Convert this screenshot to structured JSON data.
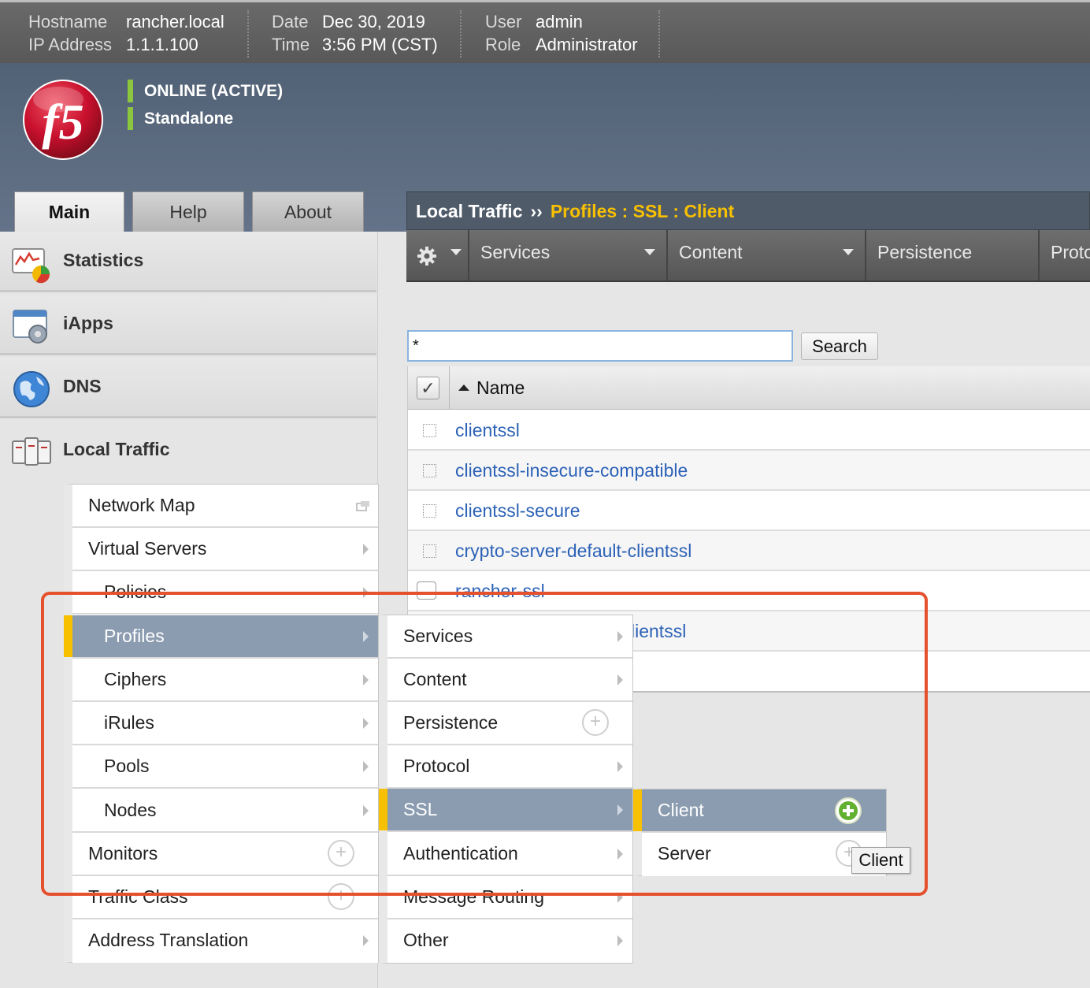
{
  "topbar": {
    "hostname_label": "Hostname",
    "hostname": "rancher.local",
    "ip_label": "IP Address",
    "ip": "1.1.1.100",
    "date_label": "Date",
    "date": "Dec 30, 2019",
    "time_label": "Time",
    "time": "3:56 PM (CST)",
    "user_label": "User",
    "user": "admin",
    "role_label": "Role",
    "role": "Administrator"
  },
  "status": {
    "online": "ONLINE (ACTIVE)",
    "mode": "Standalone",
    "indicator_color": "#8cc63f"
  },
  "logo": {
    "text": "f5",
    "color": "#c8102e"
  },
  "tabs": [
    {
      "label": "Main"
    },
    {
      "label": "Help"
    },
    {
      "label": "About"
    }
  ],
  "breadcrumb": {
    "section": "Local Traffic",
    "separator": "››",
    "current": "Profiles : SSL : Client"
  },
  "navbar": {
    "gear_icon": "gear-icon",
    "items": [
      {
        "label": "Services"
      },
      {
        "label": "Content"
      },
      {
        "label": "Persistence"
      },
      {
        "label": "Proto"
      }
    ]
  },
  "sidebar": {
    "categories": [
      {
        "label": "Statistics",
        "icon": "statistics-icon"
      },
      {
        "label": "iApps",
        "icon": "iapps-icon"
      },
      {
        "label": "DNS",
        "icon": "globe-icon"
      },
      {
        "label": "Local Traffic",
        "icon": "local-traffic-icon"
      }
    ],
    "local_traffic_menu": [
      {
        "label": "Network Map"
      },
      {
        "label": "Virtual Servers"
      },
      {
        "label": "Policies"
      },
      {
        "label": "Profiles"
      },
      {
        "label": "Ciphers"
      },
      {
        "label": "iRules"
      },
      {
        "label": "Pools"
      },
      {
        "label": "Nodes"
      },
      {
        "label": "Monitors"
      },
      {
        "label": "Traffic Class"
      },
      {
        "label": "Address Translation"
      }
    ]
  },
  "profiles_menu": [
    {
      "label": "Services"
    },
    {
      "label": "Content"
    },
    {
      "label": "Persistence"
    },
    {
      "label": "Protocol"
    },
    {
      "label": "SSL"
    },
    {
      "label": "Authentication"
    },
    {
      "label": "Message Routing"
    },
    {
      "label": "Other"
    }
  ],
  "ssl_menu": [
    {
      "label": "Client"
    },
    {
      "label": "Server"
    }
  ],
  "tooltip": "Client",
  "search": {
    "value": "*",
    "button": "Search"
  },
  "table": {
    "header": "Name",
    "rows": [
      {
        "name": "clientssl"
      },
      {
        "name": "clientssl-insecure-compatible"
      },
      {
        "name": "clientssl-secure"
      },
      {
        "name": "crypto-server-default-clientssl"
      },
      {
        "name": "rancher-ssl"
      },
      {
        "name": "lientssl"
      }
    ]
  },
  "colors": {
    "accent": "#f7c000",
    "link": "#2d62b7",
    "highlight": "#e5502d",
    "selected": "#8c9cb0"
  }
}
